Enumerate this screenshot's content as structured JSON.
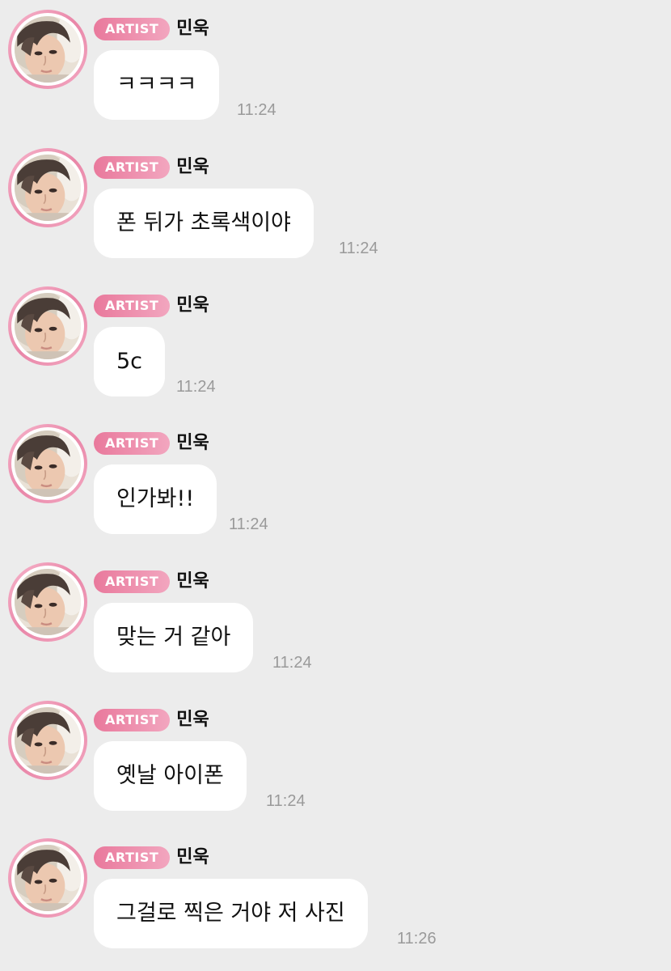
{
  "chat": {
    "messages": [
      {
        "badge": "ARTIST",
        "sender": "민욱",
        "text": "ㅋㅋㅋㅋ",
        "time": "11:24"
      },
      {
        "badge": "ARTIST",
        "sender": "민욱",
        "text": "폰 뒤가 초록색이야",
        "time": "11:24"
      },
      {
        "badge": "ARTIST",
        "sender": "민욱",
        "text": "5c",
        "time": "11:24"
      },
      {
        "badge": "ARTIST",
        "sender": "민욱",
        "text": "인가봐!!",
        "time": "11:24"
      },
      {
        "badge": "ARTIST",
        "sender": "민욱",
        "text": "맞는 거 같아",
        "time": "11:24"
      },
      {
        "badge": "ARTIST",
        "sender": "민욱",
        "text": "옛날 아이폰",
        "time": "11:24"
      },
      {
        "badge": "ARTIST",
        "sender": "민욱",
        "text": "그걸로 찍은 거야 저 사진",
        "time": "11:26"
      }
    ]
  },
  "colors": {
    "background": "#ececec",
    "bubble": "#ffffff",
    "badge_start": "#e9799c",
    "badge_end": "#f2a6bf",
    "avatar_ring": "#e986a8",
    "time_text": "#9a9a9a"
  },
  "icons": {
    "avatar": "artist-profile-photo"
  }
}
